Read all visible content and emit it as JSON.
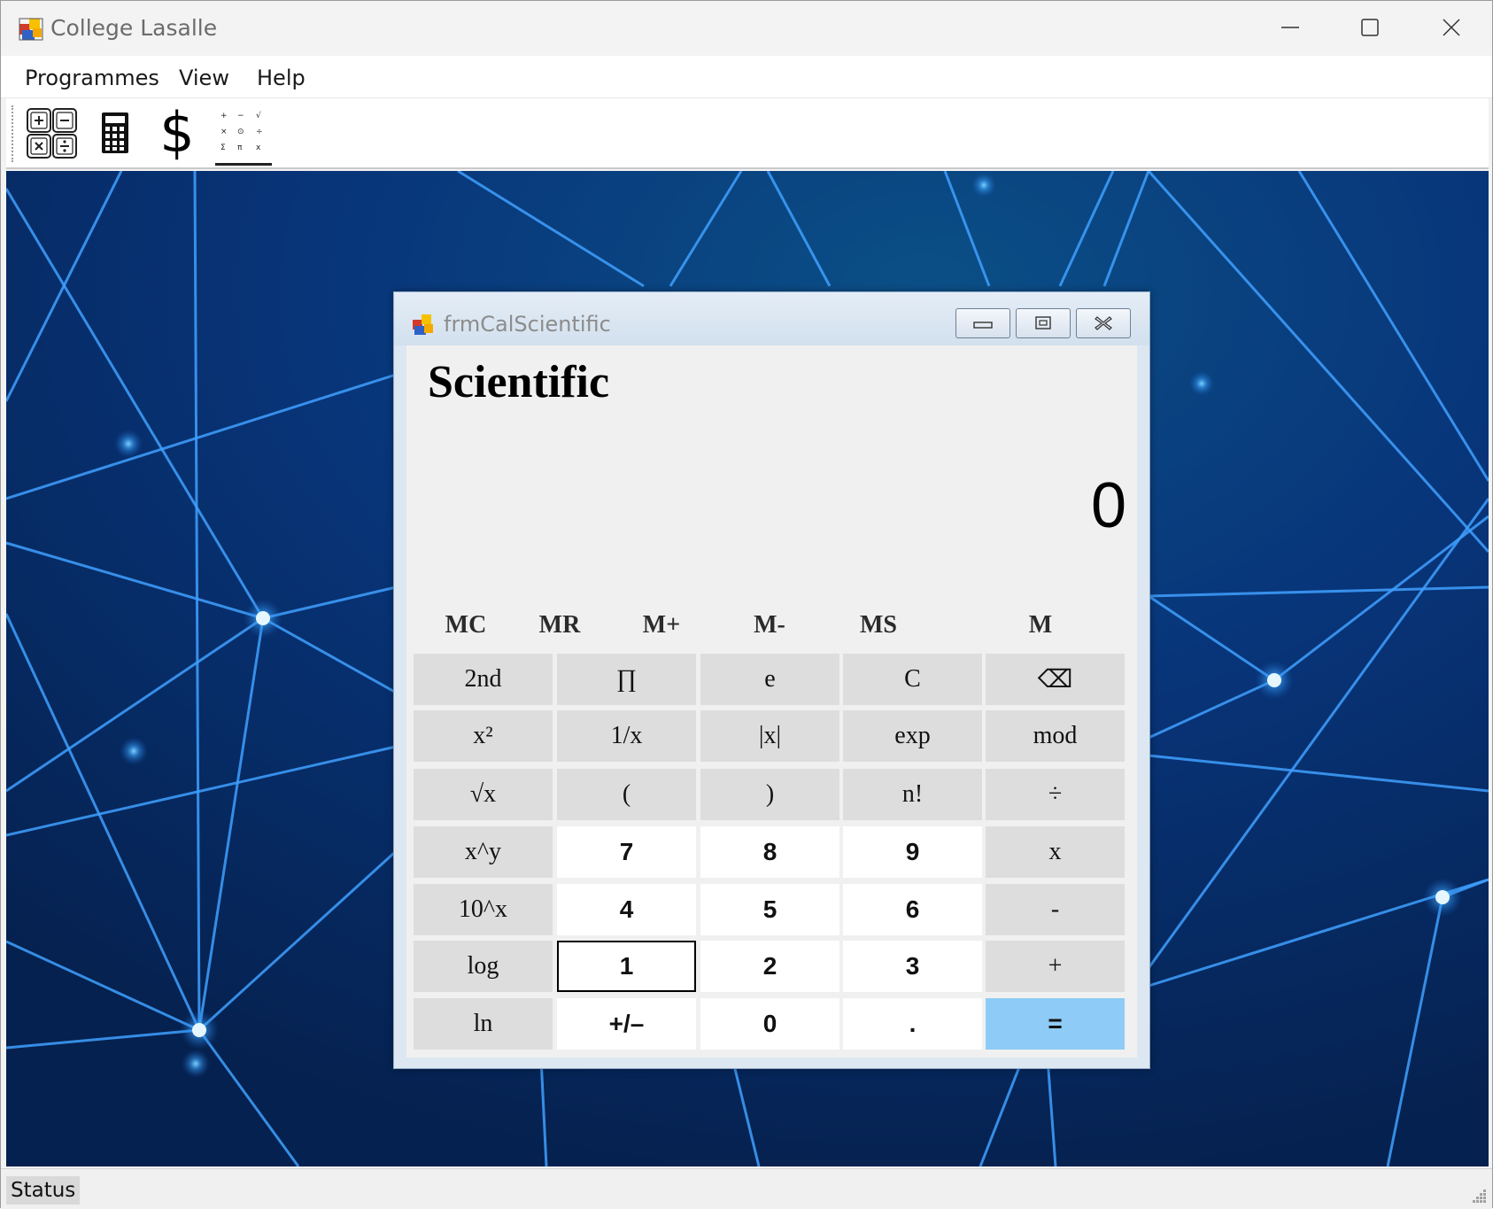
{
  "app": {
    "title": "College Lasalle"
  },
  "menu": [
    "Programmes",
    "View",
    "Help"
  ],
  "toolbar": [
    {
      "icon": "basic-calculator-icon"
    },
    {
      "icon": "calculator-icon"
    },
    {
      "icon": "dollar-icon"
    },
    {
      "icon": "scientific-grid-icon",
      "active": true
    }
  ],
  "status": {
    "label": "Status"
  },
  "calc": {
    "window_title": "frmCalScientific",
    "heading": "Scientific",
    "display": "0",
    "memory": [
      "MC",
      "MR",
      "M+",
      "M-",
      "MS",
      "M"
    ],
    "keys": [
      [
        "2nd",
        "∏",
        "e",
        "C",
        "⌫"
      ],
      [
        "x²",
        "1/x",
        "|x|",
        "exp",
        "mod"
      ],
      [
        "√x",
        "(",
        ")",
        "n!",
        "÷"
      ],
      [
        "x^y",
        "7",
        "8",
        "9",
        "x"
      ],
      [
        "10^x",
        "4",
        "5",
        "6",
        "-"
      ],
      [
        "log",
        "1",
        "2",
        "3",
        "+"
      ],
      [
        "ln",
        "+/–",
        "0",
        ".",
        "="
      ]
    ],
    "accent": "#8ecbf6"
  }
}
